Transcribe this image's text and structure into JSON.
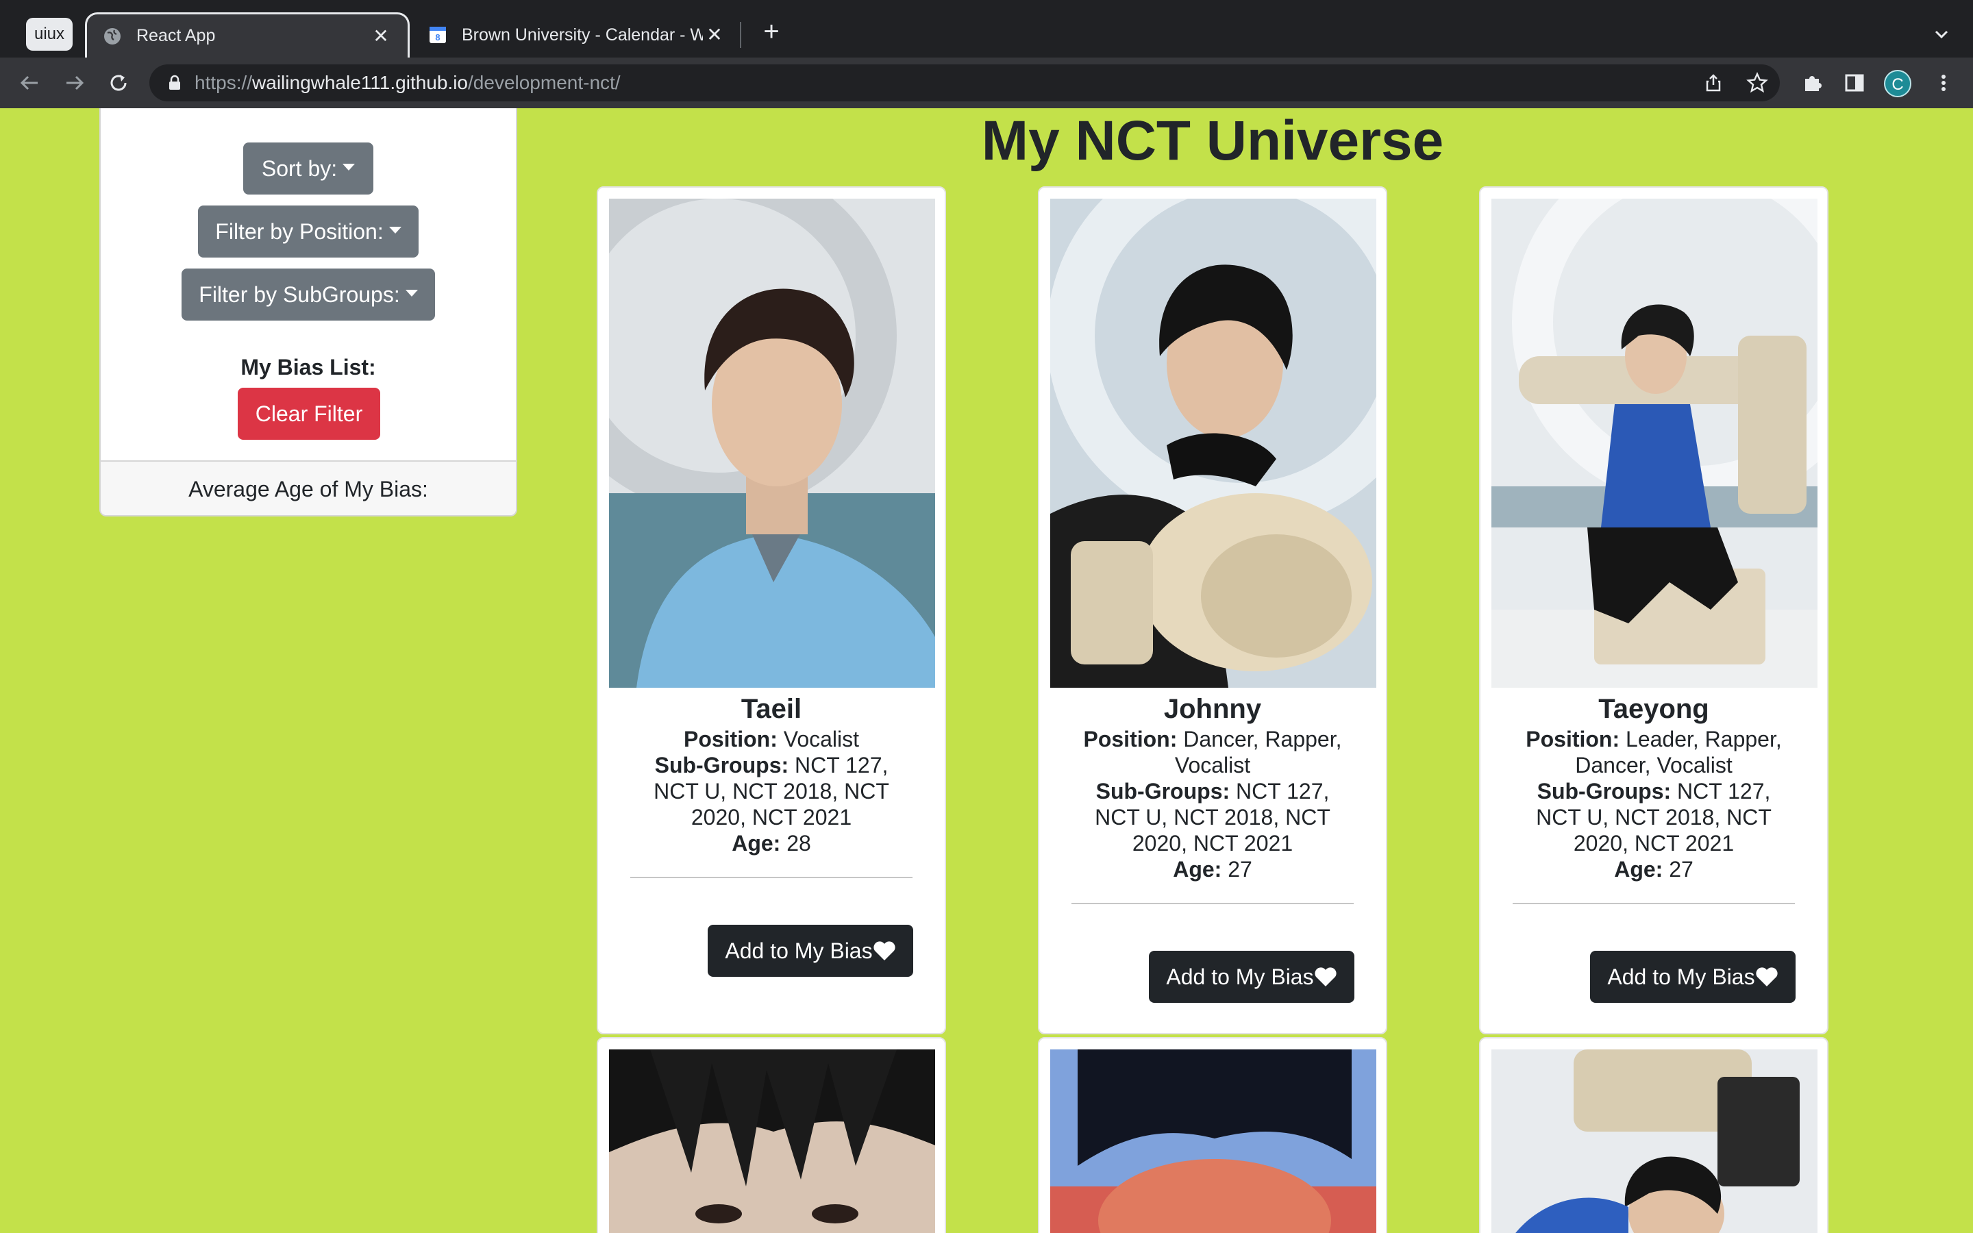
{
  "browser": {
    "profile_chip": "uiux",
    "tabs": [
      {
        "title": "React App",
        "active": true
      },
      {
        "title": "Brown University - Calendar - Week of",
        "active": false
      }
    ],
    "url_prefix": "https://",
    "url_host": "wailingwhale111.github.io",
    "url_path": "/development-nct/",
    "avatar_letter": "C"
  },
  "sidebar": {
    "sort_label": "Sort by:",
    "filter_position_label": "Filter by Position:",
    "filter_subgroups_label": "Filter by SubGroups:",
    "bias_list_label": "My Bias List:",
    "clear_filter_label": "Clear Filter",
    "average_age_label": "Average Age of My Bias:"
  },
  "page": {
    "title": "My NCT Universe"
  },
  "labels": {
    "position": "Position:",
    "subgroups": "Sub-Groups:",
    "age": "Age:",
    "add_button": "Add to My Bias"
  },
  "cards": [
    {
      "name": "Taeil",
      "position": "Vocalist",
      "subgroups": "NCT 127, NCT U, NCT 2018, NCT 2020, NCT 2021",
      "age": "28"
    },
    {
      "name": "Johnny",
      "position": "Dancer, Rapper, Vocalist",
      "subgroups": "NCT 127, NCT U, NCT 2018, NCT 2020, NCT 2021",
      "age": "27"
    },
    {
      "name": "Taeyong",
      "position": "Leader, Rapper, Dancer, Vocalist",
      "subgroups": "NCT 127, NCT U, NCT 2018, NCT 2020, NCT 2021",
      "age": "27"
    }
  ],
  "colors": {
    "page_background": "#c3e14a",
    "button_gray": "#6c757d",
    "button_red": "#dc3545",
    "button_dark": "#212529"
  }
}
